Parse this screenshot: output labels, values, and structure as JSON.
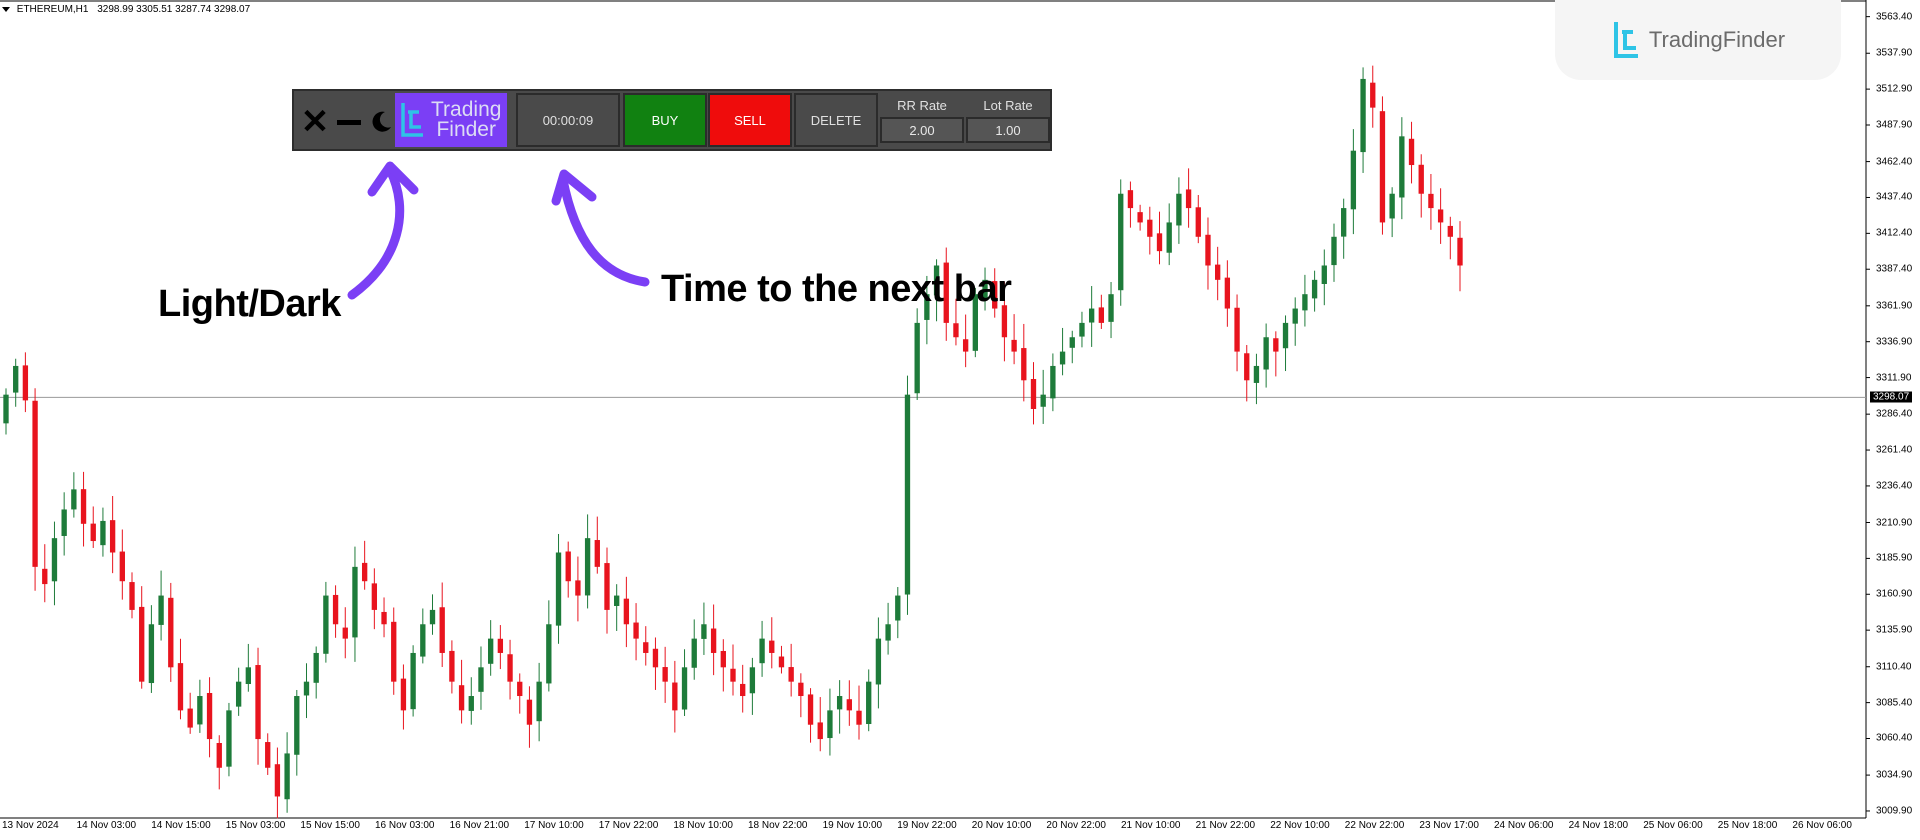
{
  "header": {
    "symbol": "ETHEREUM,H1",
    "ohlc": "3298.99 3305.51 3287.74 3298.07"
  },
  "logo": {
    "text": "TradingFinder"
  },
  "panel": {
    "close_label": "✕",
    "brand_line1": "Trading",
    "brand_line2": "Finder",
    "timer": "00:00:09",
    "buy_label": "BUY",
    "sell_label": "SELL",
    "delete_label": "DELETE",
    "rr_label": "RR Rate",
    "rr_value": "2.00",
    "lot_label": "Lot Rate",
    "lot_value": "1.00"
  },
  "annotations": {
    "light_dark": "Light/Dark",
    "time_next_bar": "Time to the next bar"
  },
  "colors": {
    "bull": "#1e7b3a",
    "bear": "#e8141e",
    "arrow": "#7b3ff5",
    "buy": "#118111",
    "sell": "#ef0c0c"
  },
  "icons": {
    "close": "close-icon",
    "minimize": "minimize-icon",
    "theme": "moon-icon",
    "logo": "tradingfinder-logo-icon"
  },
  "price_axis": {
    "labels": [
      "3563.40",
      "3537.90",
      "3512.90",
      "3487.90",
      "3462.40",
      "3437.40",
      "3412.40",
      "3387.40",
      "3361.90",
      "3336.90",
      "3311.90",
      "3286.40",
      "3261.40",
      "3236.40",
      "3210.90",
      "3185.90",
      "3160.90",
      "3135.90",
      "3110.40",
      "3085.40",
      "3060.40",
      "3034.90",
      "3009.90"
    ],
    "current": "3298.07"
  },
  "time_axis": {
    "labels": [
      "13 Nov 2024",
      "14 Nov 03:00",
      "14 Nov 15:00",
      "15 Nov 03:00",
      "15 Nov 15:00",
      "16 Nov 03:00",
      "16 Nov 21:00",
      "17 Nov 10:00",
      "17 Nov 22:00",
      "18 Nov 10:00",
      "18 Nov 22:00",
      "19 Nov 10:00",
      "19 Nov 22:00",
      "20 Nov 10:00",
      "20 Nov 22:00",
      "21 Nov 10:00",
      "21 Nov 22:00",
      "22 Nov 10:00",
      "22 Nov 22:00",
      "23 Nov 17:00",
      "24 Nov 06:00",
      "24 Nov 18:00",
      "25 Nov 06:00",
      "25 Nov 18:00",
      "26 Nov 06:00"
    ]
  },
  "chart_data": {
    "type": "candlestick",
    "timeframe": "H1",
    "current_price": 3298.07,
    "ylim": [
      3005,
      3575
    ],
    "close_series": [
      3300,
      3320,
      3296,
      3180,
      3168,
      3200,
      3220,
      3234,
      3210,
      3198,
      3212,
      3190,
      3170,
      3150,
      3100,
      3140,
      3160,
      3110,
      3080,
      3068,
      3090,
      3060,
      3040,
      3080,
      3100,
      3110,
      3060,
      3040,
      3020,
      3050,
      3090,
      3100,
      3120,
      3160,
      3140,
      3130,
      3180,
      3170,
      3150,
      3140,
      3100,
      3080,
      3120,
      3140,
      3150,
      3120,
      3100,
      3080,
      3090,
      3110,
      3130,
      3120,
      3100,
      3090,
      3070,
      3100,
      3140,
      3190,
      3170,
      3160,
      3200,
      3180,
      3150,
      3160,
      3140,
      3130,
      3120,
      3110,
      3100,
      3080,
      3110,
      3130,
      3140,
      3120,
      3110,
      3100,
      3090,
      3110,
      3130,
      3120,
      3110,
      3100,
      3090,
      3070,
      3060,
      3080,
      3090,
      3080,
      3070,
      3100,
      3130,
      3140,
      3160,
      3300,
      3350,
      3370,
      3390,
      3350,
      3340,
      3330,
      3370,
      3380,
      3360,
      3340,
      3330,
      3310,
      3290,
      3300,
      3320,
      3330,
      3340,
      3350,
      3360,
      3350,
      3370,
      3440,
      3430,
      3420,
      3410,
      3400,
      3420,
      3440,
      3430,
      3410,
      3390,
      3380,
      3360,
      3330,
      3310,
      3320,
      3340,
      3330,
      3350,
      3360,
      3370,
      3380,
      3390,
      3410,
      3430,
      3470,
      3520,
      3500,
      3420,
      3440,
      3480,
      3460,
      3440,
      3430,
      3420,
      3410,
      3390
    ]
  }
}
